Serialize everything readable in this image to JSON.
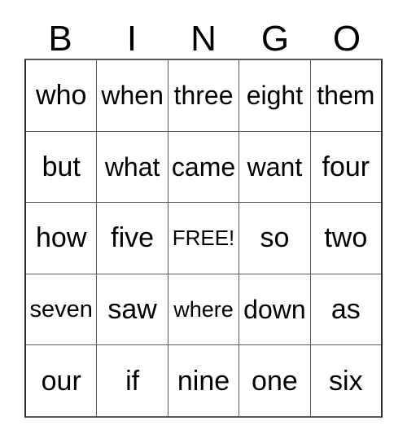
{
  "card": {
    "title_letters": [
      "B",
      "I",
      "N",
      "G",
      "O"
    ],
    "free_space_label": "FREE!",
    "grid": {
      "columns": 5,
      "rows": 5,
      "border_color": "#2b2b2b",
      "line_color": "#5a5a5a",
      "background_color": "#ffffff",
      "text_color": "#000000"
    },
    "rows": [
      [
        {
          "text": "who",
          "size": "l"
        },
        {
          "text": "when",
          "size": "m"
        },
        {
          "text": "three",
          "size": "m"
        },
        {
          "text": "eight",
          "size": "m"
        },
        {
          "text": "them",
          "size": "m"
        }
      ],
      [
        {
          "text": "but",
          "size": "l"
        },
        {
          "text": "what",
          "size": "m"
        },
        {
          "text": "came",
          "size": "m"
        },
        {
          "text": "want",
          "size": "m"
        },
        {
          "text": "four",
          "size": "l"
        }
      ],
      [
        {
          "text": "how",
          "size": "l"
        },
        {
          "text": "five",
          "size": "l"
        },
        {
          "text": "FREE!",
          "size": "free"
        },
        {
          "text": "so",
          "size": "l"
        },
        {
          "text": "two",
          "size": "l"
        }
      ],
      [
        {
          "text": "seven",
          "size": "s"
        },
        {
          "text": "saw",
          "size": "l"
        },
        {
          "text": "where",
          "size": "xs"
        },
        {
          "text": "down",
          "size": "m"
        },
        {
          "text": "as",
          "size": "l"
        }
      ],
      [
        {
          "text": "our",
          "size": "l"
        },
        {
          "text": "if",
          "size": "l"
        },
        {
          "text": "nine",
          "size": "l"
        },
        {
          "text": "one",
          "size": "l"
        },
        {
          "text": "six",
          "size": "l"
        }
      ]
    ]
  }
}
